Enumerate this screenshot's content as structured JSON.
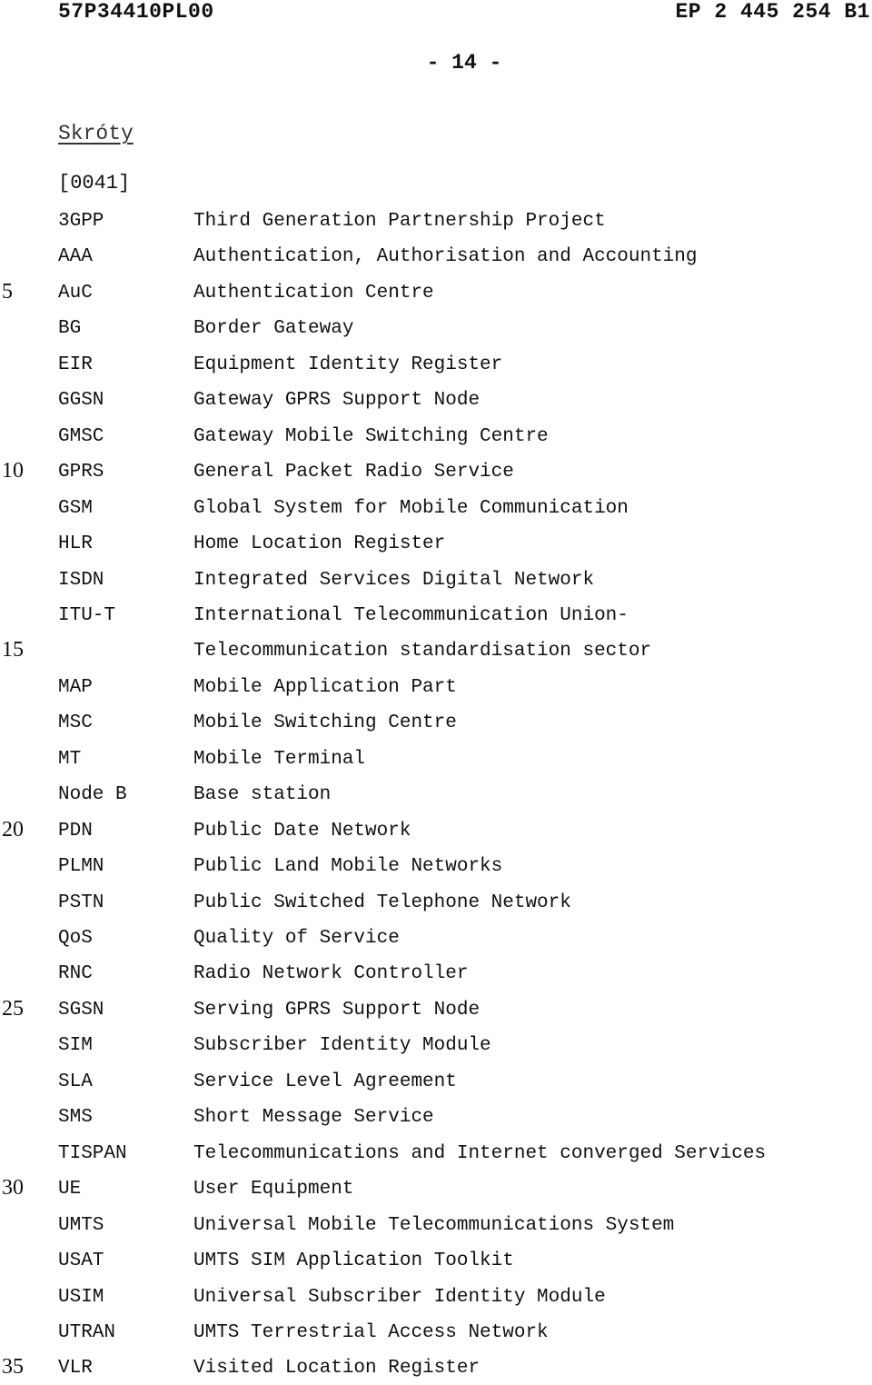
{
  "header": {
    "doc_code": "57P34410PL00",
    "patent_number": "EP 2 445 254 B1",
    "page_number": "- 14 -"
  },
  "section": {
    "title": "Skróty",
    "paragraph_number": "[0041]"
  },
  "abbreviations": [
    {
      "line": "",
      "abbr": "3GPP",
      "definition": "Third Generation Partnership Project"
    },
    {
      "line": "",
      "abbr": "AAA",
      "definition": "Authentication, Authorisation and Accounting"
    },
    {
      "line": "5",
      "abbr": "AuC",
      "definition": "Authentication Centre"
    },
    {
      "line": "",
      "abbr": "BG",
      "definition": "Border Gateway"
    },
    {
      "line": "",
      "abbr": "EIR",
      "definition": "Equipment Identity Register"
    },
    {
      "line": "",
      "abbr": "GGSN",
      "definition": "Gateway GPRS Support Node"
    },
    {
      "line": "",
      "abbr": "GMSC",
      "definition": "Gateway Mobile Switching Centre"
    },
    {
      "line": "10",
      "abbr": "GPRS",
      "definition": "General Packet Radio Service"
    },
    {
      "line": "",
      "abbr": "GSM",
      "definition": "Global System for Mobile Communication"
    },
    {
      "line": "",
      "abbr": "HLR",
      "definition": "Home Location Register"
    },
    {
      "line": "",
      "abbr": "ISDN",
      "definition": "Integrated Services Digital Network"
    },
    {
      "line": "",
      "abbr": "ITU-T",
      "definition": "International Telecommunication Union-"
    },
    {
      "line": "15",
      "abbr": "",
      "definition": "Telecommunication standardisation sector"
    },
    {
      "line": "",
      "abbr": "MAP",
      "definition": "Mobile Application Part"
    },
    {
      "line": "",
      "abbr": "MSC",
      "definition": "Mobile Switching Centre"
    },
    {
      "line": "",
      "abbr": "MT",
      "definition": "Mobile Terminal"
    },
    {
      "line": "",
      "abbr": "Node B",
      "definition": "Base station"
    },
    {
      "line": "20",
      "abbr": "PDN",
      "definition": "Public Date Network"
    },
    {
      "line": "",
      "abbr": "PLMN",
      "definition": "Public Land Mobile Networks"
    },
    {
      "line": "",
      "abbr": "PSTN",
      "definition": "Public Switched Telephone Network"
    },
    {
      "line": "",
      "abbr": "QoS",
      "definition": "Quality of Service"
    },
    {
      "line": "",
      "abbr": "RNC",
      "definition": "Radio Network Controller"
    },
    {
      "line": "25",
      "abbr": "SGSN",
      "definition": "Serving GPRS Support Node"
    },
    {
      "line": "",
      "abbr": "SIM",
      "definition": "Subscriber Identity Module"
    },
    {
      "line": "",
      "abbr": "SLA",
      "definition": "Service Level Agreement"
    },
    {
      "line": "",
      "abbr": "SMS",
      "definition": "Short Message Service"
    },
    {
      "line": "",
      "abbr": "TISPAN",
      "definition": "Telecommunications and Internet converged Services"
    },
    {
      "line": "30",
      "abbr": "UE",
      "definition": "User Equipment"
    },
    {
      "line": "",
      "abbr": "UMTS",
      "definition": "Universal Mobile Telecommunications System"
    },
    {
      "line": "",
      "abbr": "USAT",
      "definition": "UMTS SIM Application Toolkit"
    },
    {
      "line": "",
      "abbr": "USIM",
      "definition": "Universal Subscriber Identity Module"
    },
    {
      "line": "",
      "abbr": "UTRAN",
      "definition": "UMTS Terrestrial Access Network"
    },
    {
      "line": "35",
      "abbr": "VLR",
      "definition": "Visited Location Register"
    }
  ]
}
